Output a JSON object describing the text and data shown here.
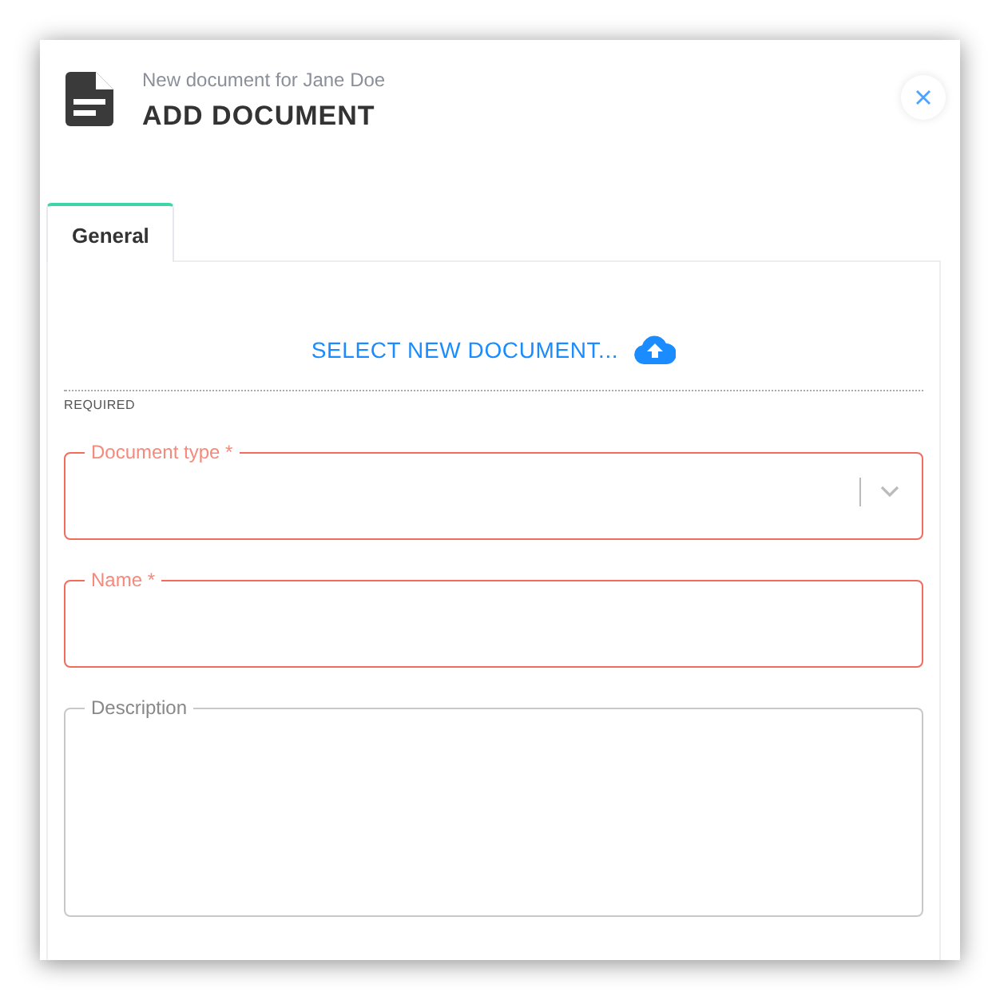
{
  "header": {
    "subtitle": "New document for Jane Doe",
    "title": "ADD DOCUMENT"
  },
  "tabs": [
    {
      "label": "General",
      "selected": true
    }
  ],
  "upload": {
    "label": "SELECT NEW DOCUMENT..."
  },
  "section": {
    "label": "REQUIRED"
  },
  "fields": [
    {
      "kind": "select",
      "label": "Document type *",
      "error": true
    },
    {
      "kind": "text",
      "label": "Name *",
      "error": true
    },
    {
      "kind": "textarea",
      "label": "Description",
      "error": false
    }
  ]
}
